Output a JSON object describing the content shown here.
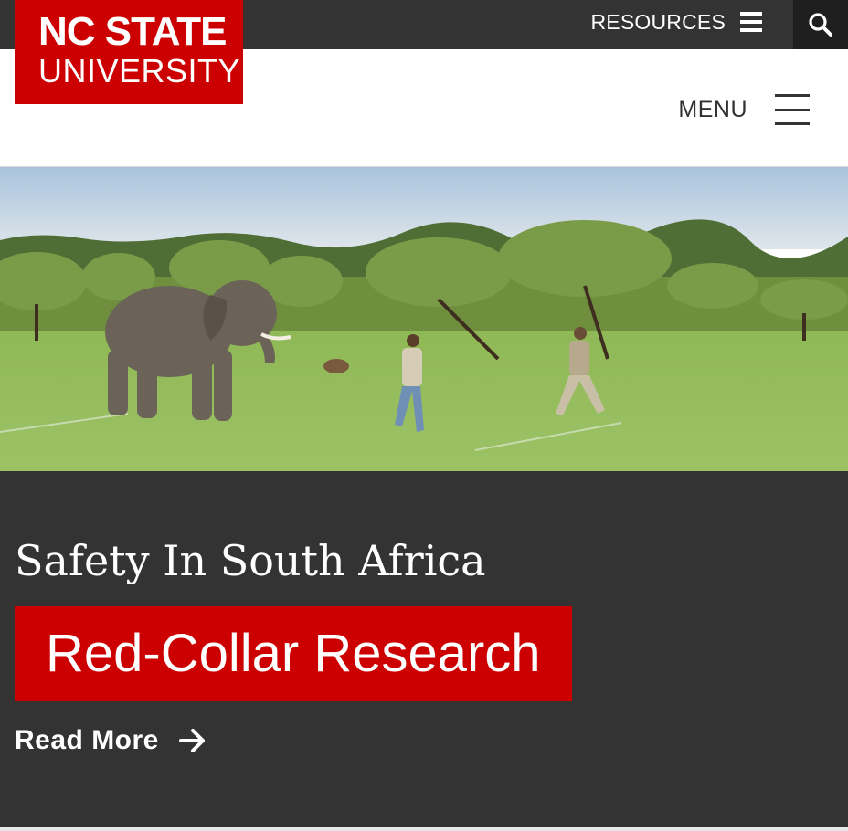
{
  "brand": {
    "line1": "NC STATE",
    "line2": "UNIVERSITY",
    "color": "#cc0000"
  },
  "utility_bar": {
    "resources_label": "RESOURCES",
    "resources_icon": "bars-icon",
    "search_icon": "search-icon",
    "background": "#333333"
  },
  "header": {
    "menu_label": "MENU",
    "menu_icon": "hamburger-icon"
  },
  "hero": {
    "image": "savanna-elephant-researchers-photo"
  },
  "feature": {
    "kicker": "Safety In South Africa",
    "title": "Red-Collar Research",
    "read_more_label": "Read More",
    "read_more_icon": "arrow-right-icon",
    "accent": "#cc0000",
    "background": "#333333"
  }
}
